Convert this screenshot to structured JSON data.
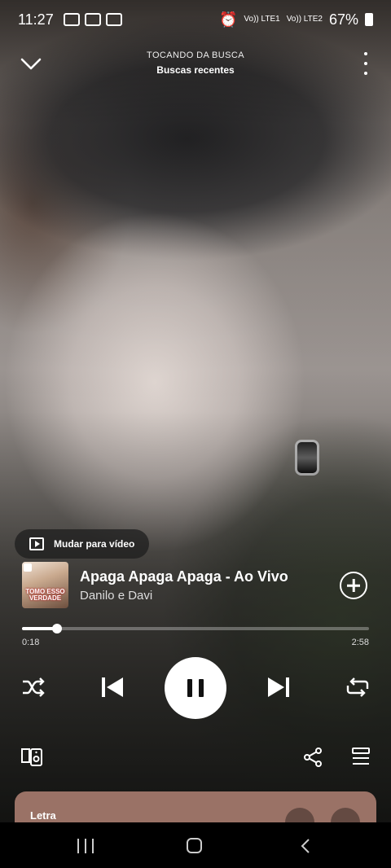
{
  "status_bar": {
    "time": "11:27",
    "sim1": "Vo)) LTE1",
    "sim2": "Vo)) LTE2",
    "battery": "67%"
  },
  "header": {
    "context_type": "TOCANDO DA BUSCA",
    "context_name": "Buscas recentes",
    "icons": {
      "collapse": "chevron-down-icon",
      "more": "more-vertical-icon"
    }
  },
  "video_chip": {
    "label": "Mudar para vídeo",
    "icon": "play-square-icon"
  },
  "track": {
    "title": "Apaga Apaga Apaga - Ao Vivo",
    "artist": "Danilo e Davi",
    "album_art_text": "TOMO ESSO VERDADE"
  },
  "progress": {
    "elapsed": "0:18",
    "total": "2:58",
    "fraction": 0.101
  },
  "controls": {
    "shuffle": "shuffle-icon",
    "previous": "skip-previous-icon",
    "play_state": "playing",
    "next": "skip-next-icon",
    "repeat": "repeat-icon"
  },
  "bottom_actions": {
    "devices": "connect-devices-icon",
    "share": "share-icon",
    "queue": "queue-icon"
  },
  "lyrics_card": {
    "label": "Letra",
    "accent": "#9a7266"
  },
  "colors": {
    "accent": "#ffffff",
    "lyrics_bg": "#9a7266"
  }
}
